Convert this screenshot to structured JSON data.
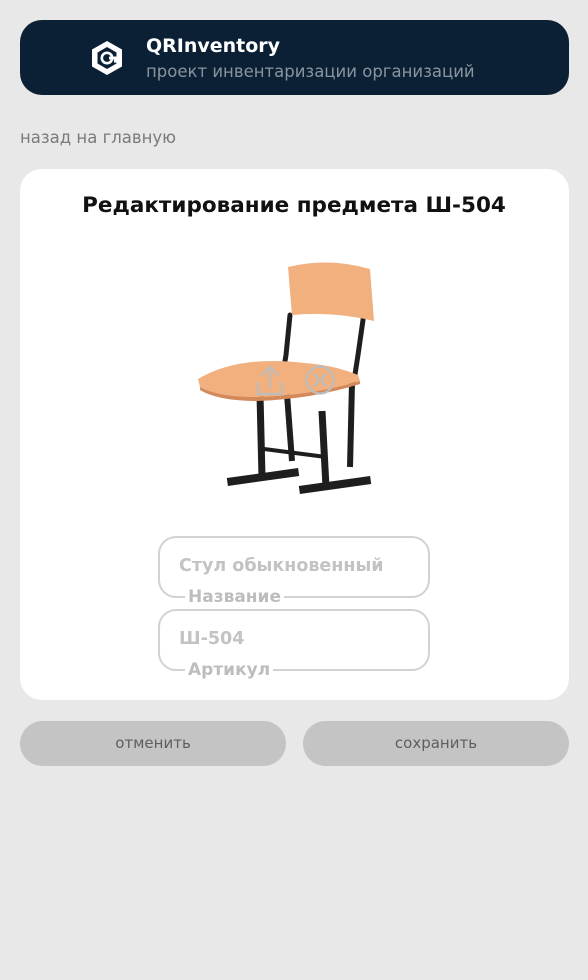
{
  "header": {
    "title": "QRInventory",
    "subtitle": "проект инвентаризации организаций",
    "logo_icon": "qrinventory-logo-icon"
  },
  "nav": {
    "back_label": "назад на главную"
  },
  "card": {
    "title": "Редактирование предмета Ш-504",
    "photo": {
      "alt": "chair-photo",
      "upload_icon": "upload-icon",
      "remove_icon": "close-circle-icon"
    },
    "fields": [
      {
        "value": "Стул обыкновенный",
        "label": "Название"
      },
      {
        "value": "Ш-504",
        "label": "Артикул"
      }
    ]
  },
  "actions": {
    "cancel_label": "отменить",
    "save_label": "сохранить"
  },
  "colors": {
    "header_bg": "#0b2035",
    "page_bg": "#e8e8e8",
    "card_bg": "#ffffff",
    "button_bg": "#c4c4c4",
    "chair_wood": "#f2b07e",
    "chair_frame": "#1e1e1e"
  }
}
